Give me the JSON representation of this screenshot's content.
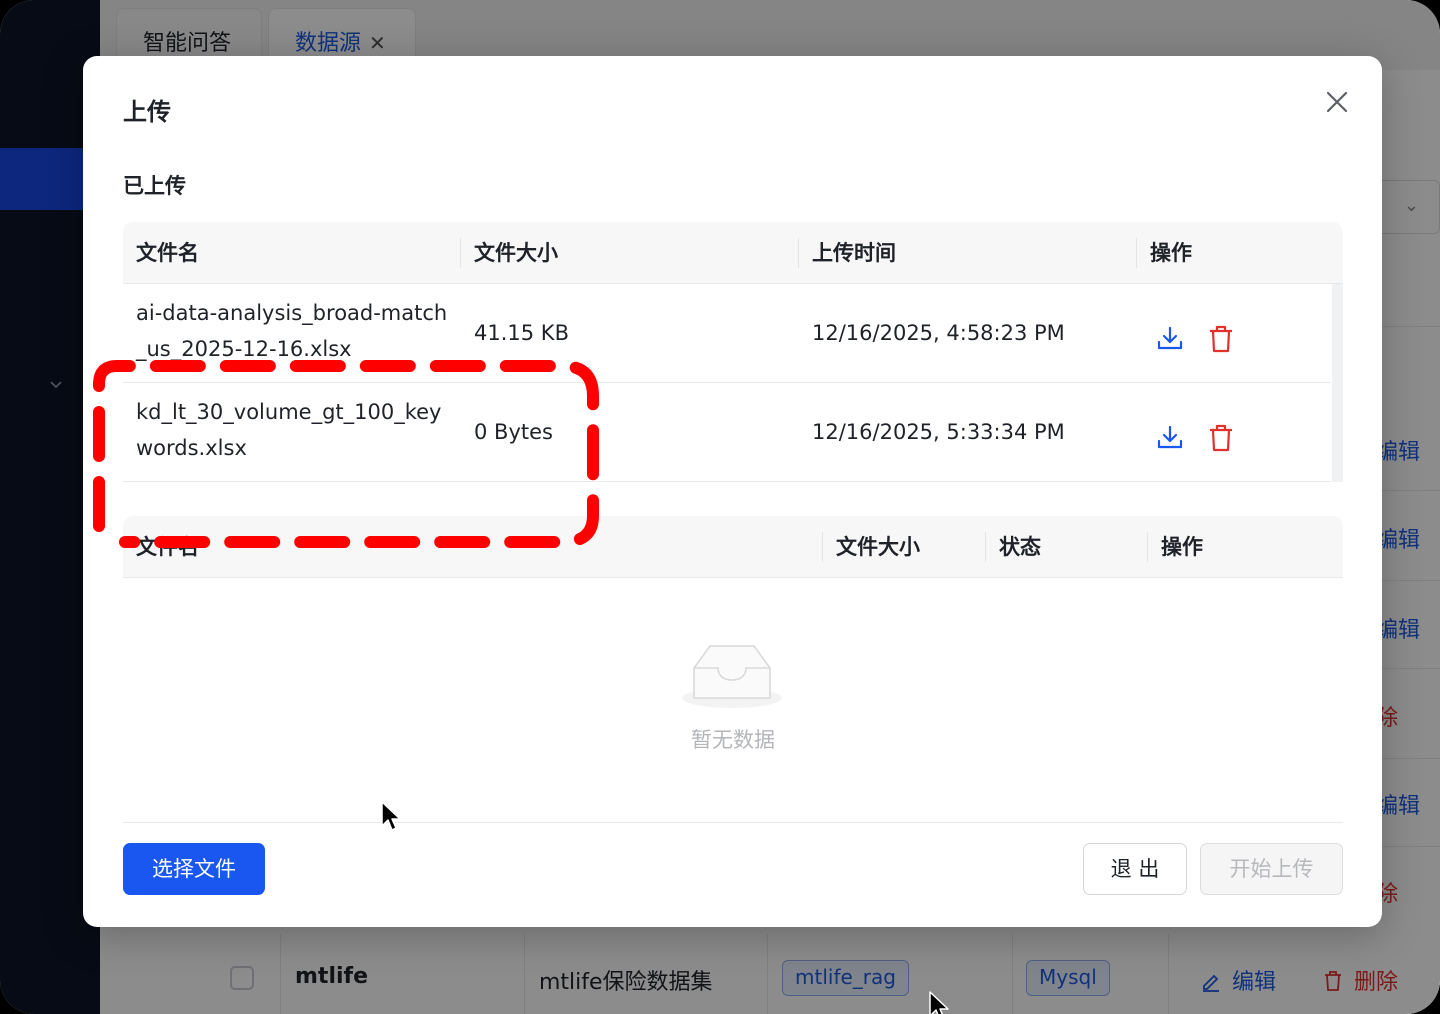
{
  "background": {
    "tabs": [
      {
        "label": "智能问答"
      },
      {
        "label": "数据源",
        "close": "✕"
      }
    ],
    "row_actions": [
      {
        "label": "编辑",
        "type": "edit"
      },
      {
        "label": "编辑",
        "type": "edit"
      },
      {
        "label": "编辑",
        "type": "edit"
      },
      {
        "label": "除",
        "type": "del"
      },
      {
        "label": "编辑",
        "type": "edit"
      },
      {
        "label": "除",
        "type": "del"
      }
    ],
    "last_row": {
      "name": "mtlife",
      "description": "mtlife保险数据集",
      "tag": "mtlife_rag",
      "db_type": "Mysql",
      "edit_label": "编辑",
      "delete_label": "删除"
    }
  },
  "modal": {
    "title": "上传",
    "uploaded_section_title": "已上传",
    "uploaded_table": {
      "columns": [
        "文件名",
        "文件大小",
        "上传时间",
        "操作"
      ],
      "rows": [
        {
          "name": "ai-data-analysis_broad-match_us_2025-12-16.xlsx",
          "size": "41.15 KB",
          "time": "12/16/2025, 4:58:23 PM"
        },
        {
          "name": "kd_lt_30_volume_gt_100_keywords.xlsx",
          "size": "0 Bytes",
          "time": "12/16/2025, 5:33:34 PM"
        }
      ]
    },
    "pending_table": {
      "columns": [
        "文件名",
        "文件大小",
        "状态",
        "操作"
      ],
      "empty_text": "暂无数据"
    },
    "buttons": {
      "select_file": "选择文件",
      "exit": "退 出",
      "start_upload": "开始上传"
    }
  },
  "colors": {
    "primary": "#1a56f0",
    "danger": "#e0312c",
    "annotation": "#ff0000"
  }
}
